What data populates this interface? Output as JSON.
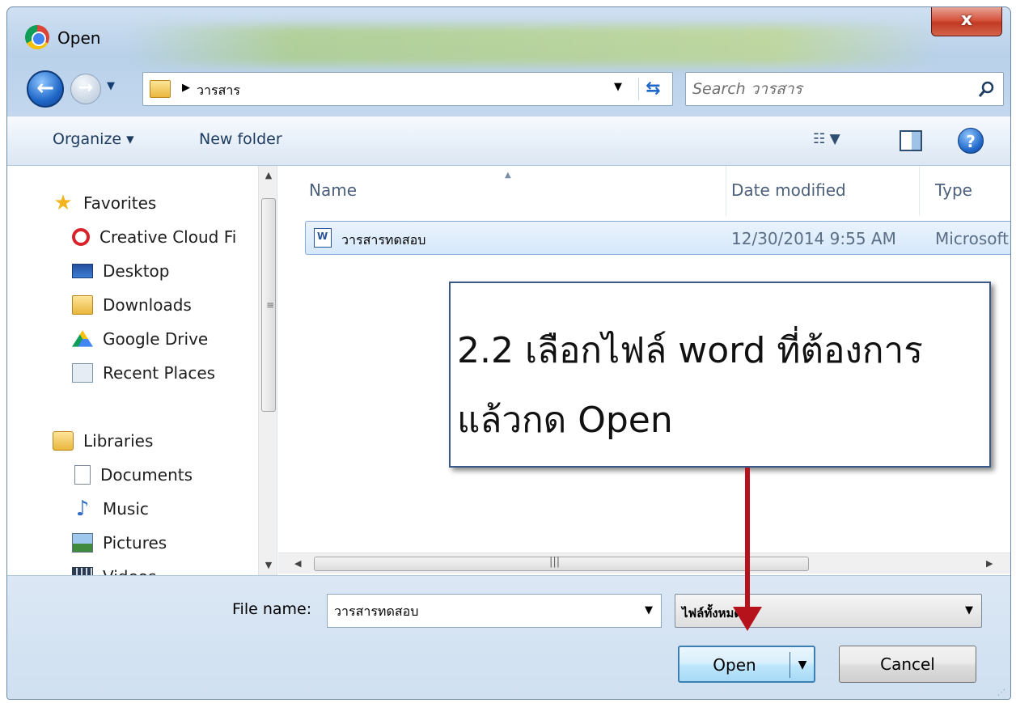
{
  "window": {
    "title": "Open",
    "close_label": "x"
  },
  "nav": {
    "breadcrumb": "วารสาร",
    "search_placeholder": "Search วารสาร"
  },
  "toolbar": {
    "organize_label": "Organize ▾",
    "new_folder_label": "New folder"
  },
  "sidebar": {
    "items": [
      {
        "label": "Favorites",
        "icon": "star-icon"
      },
      {
        "label": "Creative Cloud Fi",
        "icon": "creative-cloud-icon"
      },
      {
        "label": "Desktop",
        "icon": "desktop-icon"
      },
      {
        "label": "Downloads",
        "icon": "downloads-folder-icon"
      },
      {
        "label": "Google Drive",
        "icon": "google-drive-icon"
      },
      {
        "label": "Recent Places",
        "icon": "recent-places-icon"
      },
      {
        "label": "Libraries",
        "icon": "libraries-icon"
      },
      {
        "label": "Documents",
        "icon": "documents-icon"
      },
      {
        "label": "Music",
        "icon": "music-icon"
      },
      {
        "label": "Pictures",
        "icon": "pictures-icon"
      },
      {
        "label": "Videos",
        "icon": "videos-icon"
      }
    ]
  },
  "files": {
    "columns": [
      "Name",
      "Date modified",
      "Type"
    ],
    "rows": [
      {
        "name": "วารสารทดสอบ",
        "date": "12/30/2014 9:55 AM",
        "type": "Microsoft"
      }
    ]
  },
  "footer": {
    "file_name_label": "File name:",
    "file_name_value": "วารสารทดสอบ",
    "file_type_value": "ไฟล์ทั้งหมด",
    "open_label": "Open",
    "cancel_label": "Cancel"
  },
  "annotation": {
    "line1": "2.2 เลือกไฟล์ word ที่ต้องการ",
    "line2": "แล้วกด Open",
    "arrow_color": "#b5121b"
  }
}
